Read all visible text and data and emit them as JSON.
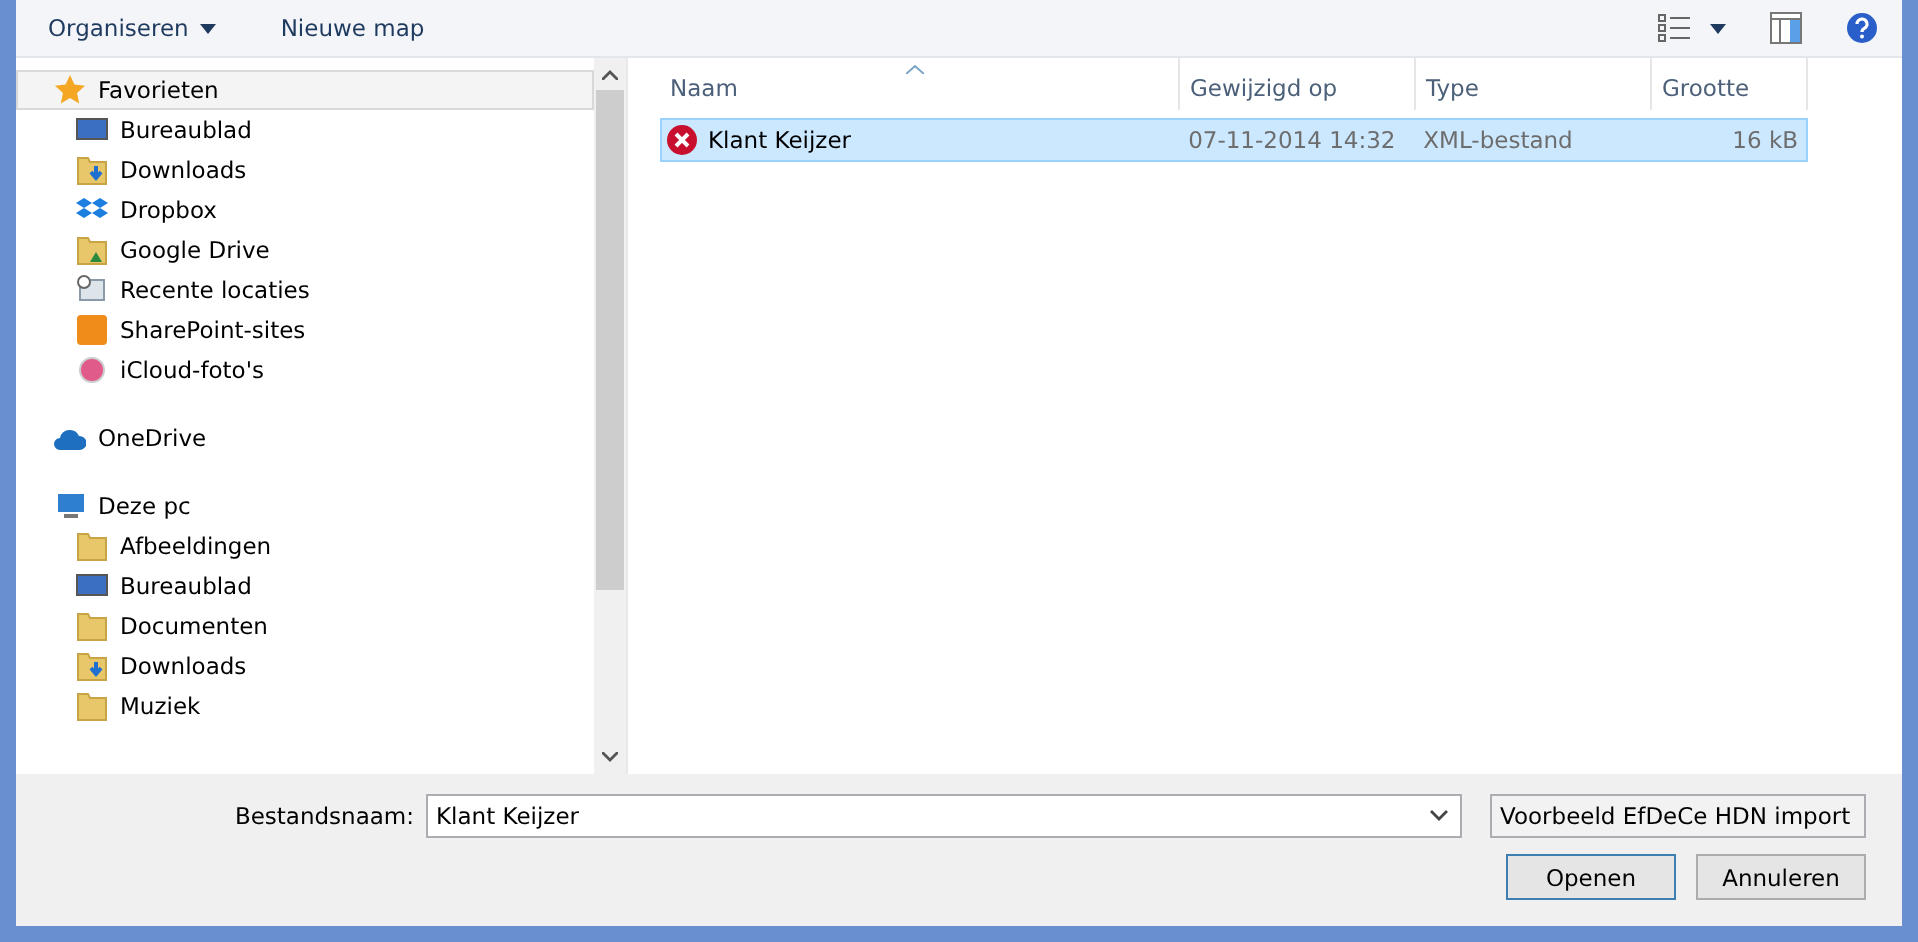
{
  "toolbar": {
    "buttons": [
      {
        "label": "Organiseren",
        "has_menu": true
      },
      {
        "label": "Nieuwe map",
        "has_menu": false
      }
    ]
  },
  "sidebar": {
    "items": [
      {
        "label": "Favorieten",
        "kind": "star",
        "selected": true,
        "children": [
          {
            "label": "Bureaublad",
            "kind": "desktop",
            "selected": false
          },
          {
            "label": "Downloads",
            "kind": "download",
            "selected": false
          },
          {
            "label": "Dropbox",
            "kind": "dropbox",
            "selected": false
          },
          {
            "label": "Google Drive",
            "kind": "drive",
            "selected": false
          },
          {
            "label": "Recente locaties",
            "kind": "recent",
            "selected": false
          },
          {
            "label": "SharePoint-sites",
            "kind": "sharepoint",
            "selected": false
          },
          {
            "label": "iCloud-foto's",
            "kind": "photos",
            "selected": false
          }
        ]
      },
      {
        "label": "OneDrive",
        "kind": "cloud",
        "selected": false
      },
      {
        "label": "Deze pc",
        "kind": "computer",
        "selected": false,
        "children": [
          {
            "label": "Afbeeldingen",
            "kind": "folder",
            "selected": false
          },
          {
            "label": "Bureaublad",
            "kind": "desktop",
            "selected": false
          },
          {
            "label": "Documenten",
            "kind": "folder",
            "selected": false
          },
          {
            "label": "Downloads",
            "kind": "download",
            "selected": false
          },
          {
            "label": "Muziek",
            "kind": "folder",
            "selected": false
          }
        ]
      }
    ]
  },
  "table": {
    "columns": [
      "Naam",
      "Gewijzigd op",
      "Type",
      "Grootte"
    ],
    "rows": [
      {
        "name": "Klant Keijzer",
        "modified": "07-11-2014 14:32",
        "type": "XML-bestand",
        "size": "16 kB",
        "selected": true
      }
    ]
  },
  "footer": {
    "filename_label": "Bestandsnaam:",
    "filename": "Klant Keijzer",
    "filter": "Voorbeeld EfDeCe HDN import",
    "buttons": [
      {
        "label": "Openen",
        "kind": "primary"
      },
      {
        "label": "Annuleren",
        "kind": "cancel"
      }
    ]
  }
}
